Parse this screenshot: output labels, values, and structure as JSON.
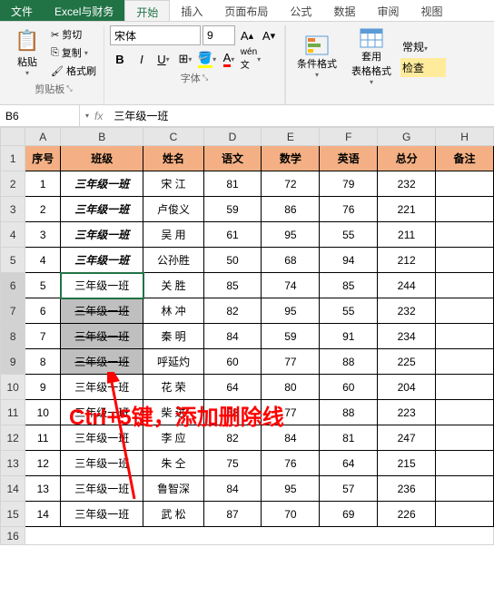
{
  "tabs": {
    "file": "文件",
    "custom": "Excel与财务",
    "start": "开始",
    "insert": "插入",
    "layout": "页面布局",
    "formula": "公式",
    "data": "数据",
    "review": "审阅",
    "view": "视图"
  },
  "ribbon": {
    "clipboard": {
      "paste": "粘贴",
      "cut": "剪切",
      "copy": "复制",
      "painter": "格式刷",
      "group": "剪贴板"
    },
    "font": {
      "name": "宋体",
      "size": "9",
      "group": "字体"
    },
    "cond": "条件格式",
    "tbl": "套用\n表格格式",
    "style": "常规",
    "check": "检查"
  },
  "namebox": {
    "ref": "B6",
    "formula": "三年级一班"
  },
  "cols": [
    "A",
    "B",
    "C",
    "D",
    "E",
    "F",
    "G",
    "H"
  ],
  "header": {
    "seq": "序号",
    "cls": "班级",
    "name": "姓名",
    "c1": "语文",
    "c2": "数学",
    "c3": "英语",
    "tot": "总分",
    "note": "备注"
  },
  "rows": [
    {
      "r": "1",
      "seq": "1",
      "cls": "三年级一班",
      "name": "宋 江",
      "c1": "81",
      "c2": "72",
      "c3": "79",
      "tot": "232",
      "bi": true
    },
    {
      "r": "2",
      "seq": "2",
      "cls": "三年级一班",
      "name": "卢俊义",
      "c1": "59",
      "c2": "86",
      "c3": "76",
      "tot": "221",
      "bi": true
    },
    {
      "r": "3",
      "seq": "3",
      "cls": "三年级一班",
      "name": "吴 用",
      "c1": "61",
      "c2": "95",
      "c3": "55",
      "tot": "211",
      "bi": true
    },
    {
      "r": "4",
      "seq": "4",
      "cls": "三年级一班",
      "name": "公孙胜",
      "c1": "50",
      "c2": "68",
      "c3": "94",
      "tot": "212",
      "bi": true
    },
    {
      "r": "5",
      "seq": "5",
      "cls": "三年级一班",
      "name": "关 胜",
      "c1": "85",
      "c2": "74",
      "c3": "85",
      "tot": "244"
    },
    {
      "r": "6",
      "seq": "6",
      "cls": "三年级一班",
      "name": "林 冲",
      "c1": "82",
      "c2": "95",
      "c3": "55",
      "tot": "232",
      "strike": true,
      "sel": true
    },
    {
      "r": "7",
      "seq": "7",
      "cls": "三年级一班",
      "name": "秦 明",
      "c1": "84",
      "c2": "59",
      "c3": "91",
      "tot": "234",
      "strike": true,
      "sel": true
    },
    {
      "r": "8",
      "seq": "8",
      "cls": "三年级一班",
      "name": "呼延灼",
      "c1": "60",
      "c2": "77",
      "c3": "88",
      "tot": "225",
      "strike": true,
      "sel": true
    },
    {
      "r": "9",
      "seq": "9",
      "cls": "三年级一班",
      "name": "花 荣",
      "c1": "64",
      "c2": "80",
      "c3": "60",
      "tot": "204"
    },
    {
      "r": "10",
      "seq": "10",
      "cls": "三年级一班",
      "name": "柴 进",
      "c1": "58",
      "c2": "77",
      "c3": "88",
      "tot": "223"
    },
    {
      "r": "11",
      "seq": "11",
      "cls": "三年级一班",
      "name": "李 应",
      "c1": "82",
      "c2": "84",
      "c3": "81",
      "tot": "247"
    },
    {
      "r": "12",
      "seq": "12",
      "cls": "三年级一班",
      "name": "朱 仝",
      "c1": "75",
      "c2": "76",
      "c3": "64",
      "tot": "215"
    },
    {
      "r": "13",
      "seq": "13",
      "cls": "三年级一班",
      "name": "鲁智深",
      "c1": "84",
      "c2": "95",
      "c3": "57",
      "tot": "236"
    },
    {
      "r": "14",
      "seq": "14",
      "cls": "三年级一班",
      "name": "武 松",
      "c1": "87",
      "c2": "70",
      "c3": "69",
      "tot": "226"
    }
  ],
  "emptyRows": [
    "16"
  ],
  "annotation": "Ctrl+5键，添加删除线"
}
